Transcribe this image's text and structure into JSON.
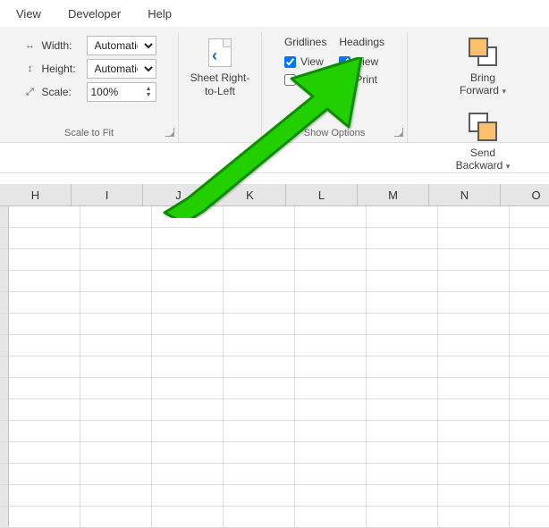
{
  "menubar": {
    "items": [
      "View",
      "Developer",
      "Help"
    ]
  },
  "ribbon": {
    "scaleToFit": {
      "groupLabel": "Scale to Fit",
      "widthLabel": "Width:",
      "heightLabel": "Height:",
      "scaleLabel": "Scale:",
      "widthValue": "Automatic",
      "heightValue": "Automatic",
      "scaleValue": "100%"
    },
    "sheetRtl": {
      "label1": "Sheet Right-",
      "label2": "to-Left"
    },
    "showOptions": {
      "groupLabel": "Show Options",
      "gridlinesLabel": "Gridlines",
      "headingsLabel": "Headings",
      "viewLabel": "View",
      "printLabel": "Print",
      "gridlinesViewChecked": true,
      "gridlinesPrintChecked": false,
      "headingsViewChecked": true,
      "headingsPrintChecked": false
    },
    "arrange": {
      "bringForwardLabel": "Bring",
      "bringForwardLabel2": "Forward",
      "sendBackwardLabel": "Send",
      "sendBackwardLabel2": "Backward"
    }
  },
  "columns": [
    "H",
    "I",
    "J",
    "K",
    "L",
    "M",
    "N",
    "O"
  ]
}
